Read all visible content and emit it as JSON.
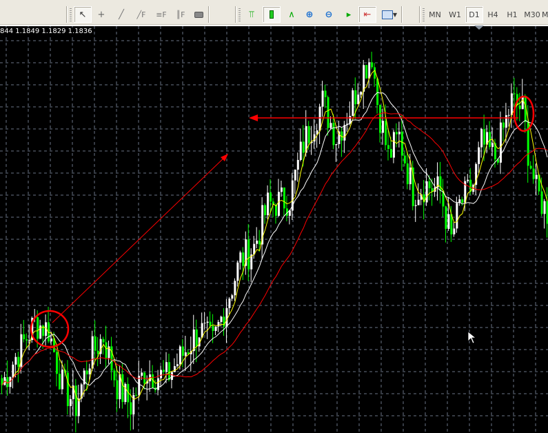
{
  "ohlc_readout": "844 1.1849 1.1829 1.1836",
  "toolbar": {
    "tools": [
      "cursor-icon",
      "crosshair-icon",
      "trendline-icon",
      "fibonacci-fan-icon",
      "fibonacci-retracement-icon",
      "fibonacci-expansion-icon",
      "rectangle-icon"
    ],
    "chart_tools": [
      "bar-chart-icon",
      "candlestick-icon",
      "line-chart-icon",
      "zoom-in-icon",
      "zoom-out-icon",
      "chart-shift-icon",
      "autoscroll-icon",
      "templates-icon"
    ],
    "periods": [
      "MN",
      "W1",
      "D1",
      "H4",
      "H1",
      "M30",
      "M"
    ],
    "active_period": "D1"
  },
  "colors": {
    "bull": "#ffffff",
    "bear": "#00ff00",
    "ma_fast": "#ffff00",
    "ma_mid": "#ffffff",
    "ma_slow": "#ff0000",
    "grid": "#6a7486",
    "annotation": "#ff0000"
  },
  "chart_data": {
    "type": "candlestick",
    "ylim": [
      1.151,
      1.21
    ],
    "candle_count": 200,
    "close_waypoints": [
      [
        0,
        1.158
      ],
      [
        5,
        1.162
      ],
      [
        12,
        1.167
      ],
      [
        17,
        1.166
      ],
      [
        22,
        1.158
      ],
      [
        27,
        1.155
      ],
      [
        32,
        1.162
      ],
      [
        37,
        1.165
      ],
      [
        42,
        1.158
      ],
      [
        47,
        1.155
      ],
      [
        52,
        1.16
      ],
      [
        60,
        1.159
      ],
      [
        67,
        1.163
      ],
      [
        72,
        1.166
      ],
      [
        77,
        1.164
      ],
      [
        82,
        1.17
      ],
      [
        87,
        1.176
      ],
      [
        92,
        1.178
      ],
      [
        97,
        1.184
      ],
      [
        105,
        1.185
      ],
      [
        110,
        1.193
      ],
      [
        117,
        1.199
      ],
      [
        122,
        1.194
      ],
      [
        127,
        1.198
      ],
      [
        131,
        1.203
      ],
      [
        135,
        1.206
      ],
      [
        137,
        1.199
      ],
      [
        141,
        1.191
      ],
      [
        145,
        1.194
      ],
      [
        150,
        1.186
      ],
      [
        155,
        1.187
      ],
      [
        160,
        1.186
      ],
      [
        164,
        1.179
      ],
      [
        167,
        1.184
      ],
      [
        172,
        1.187
      ],
      [
        175,
        1.193
      ],
      [
        180,
        1.191
      ],
      [
        186,
        1.199
      ],
      [
        190,
        1.198
      ],
      [
        192,
        1.192
      ],
      [
        195,
        1.186
      ],
      [
        199,
        1.183
      ]
    ],
    "moving_averages": [
      {
        "name": "fast",
        "period": 5
      },
      {
        "name": "mid",
        "period": 13
      },
      {
        "name": "slow",
        "period": 30
      }
    ]
  }
}
